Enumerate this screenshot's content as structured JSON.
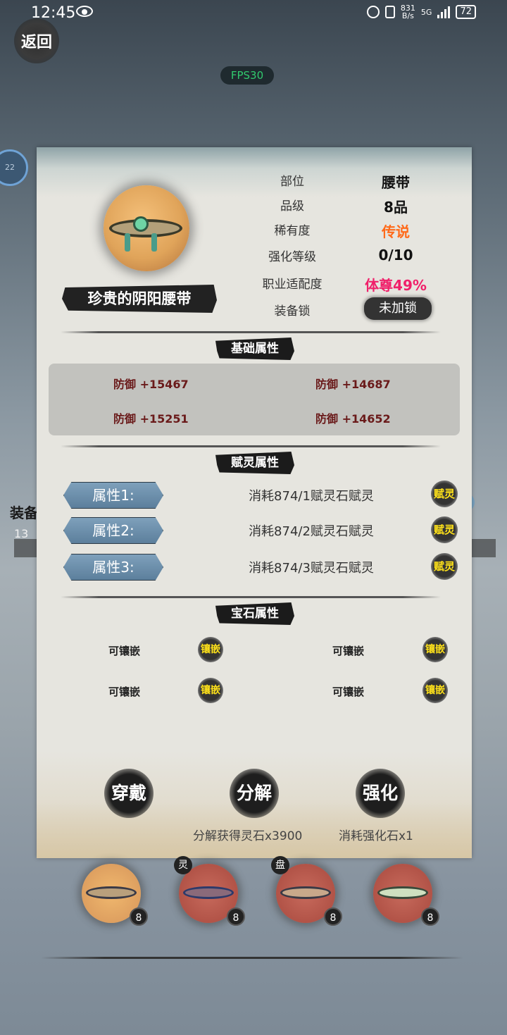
{
  "status_bar": {
    "time": "12:45",
    "net_speed_top": "831",
    "net_speed_unit": "B/s",
    "network": "5G",
    "battery": "72"
  },
  "back_label": "返回",
  "fps_label": "FPS30",
  "background": {
    "equip_label": "装备",
    "count": "13",
    "level": "22"
  },
  "item": {
    "name": "珍贵的阴阳腰带",
    "attributes": [
      {
        "key": "部位",
        "value": "腰带"
      },
      {
        "key": "品级",
        "value": "8品"
      },
      {
        "key": "稀有度",
        "value": "传说",
        "color": "#ff6a1a"
      },
      {
        "key": "强化等级",
        "value": "0/10"
      },
      {
        "key": "职业适配度",
        "value": "体尊49%",
        "color": "#f0206a"
      },
      {
        "key": "装备锁",
        "value": "未加锁"
      }
    ]
  },
  "sections": {
    "base": "基础属性",
    "enchant": "赋灵属性",
    "gem": "宝石属性"
  },
  "base_stats": [
    "防御 +15467",
    "防御 +14687",
    "防御 +15251",
    "防御 +14652"
  ],
  "enchant_rows": [
    {
      "label": "属性1:",
      "desc": "消耗874/1赋灵石赋灵",
      "button": "赋灵"
    },
    {
      "label": "属性2:",
      "desc": "消耗874/2赋灵石赋灵",
      "button": "赋灵"
    },
    {
      "label": "属性3:",
      "desc": "消耗874/3赋灵石赋灵",
      "button": "赋灵"
    }
  ],
  "gems": [
    {
      "label": "可镶嵌",
      "button": "镶嵌"
    },
    {
      "label": "可镶嵌",
      "button": "镶嵌"
    },
    {
      "label": "可镶嵌",
      "button": "镶嵌"
    },
    {
      "label": "可镶嵌",
      "button": "镶嵌"
    }
  ],
  "actions": {
    "wear": "穿戴",
    "decompose": "分解",
    "enhance": "强化",
    "decompose_note": "分解获得灵石x3900",
    "enhance_note": "消耗强化石x1"
  },
  "slots": [
    {
      "badge": "8",
      "tag": ""
    },
    {
      "badge": "8",
      "tag": "灵"
    },
    {
      "badge": "8",
      "tag": "盘"
    },
    {
      "badge": "8",
      "tag": ""
    }
  ]
}
